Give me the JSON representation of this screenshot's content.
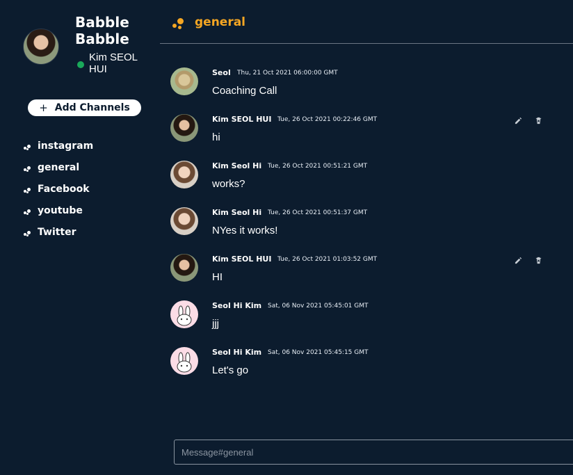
{
  "app": {
    "title": "Babble Babble"
  },
  "user": {
    "name": "Kim SEOL HUI",
    "status": "online",
    "status_color": "#1aa85a"
  },
  "sidebar": {
    "add_channels_label": "Add Channels",
    "channels": [
      {
        "label": "instagram"
      },
      {
        "label": "general"
      },
      {
        "label": "Facebook"
      },
      {
        "label": "youtube"
      },
      {
        "label": "Twitter"
      }
    ]
  },
  "header": {
    "channel_name": "general",
    "accent_color": "#f5a623"
  },
  "messages": [
    {
      "author": "Seol",
      "timestamp": "Thu, 21 Oct 2021 06:00:00 GMT",
      "text": "Coaching Call",
      "avatar": "photo-seol",
      "editable": false
    },
    {
      "author": "Kim SEOL HUI",
      "timestamp": "Tue, 26 Oct 2021 00:22:46 GMT",
      "text": "hi",
      "avatar": "photo-kim",
      "editable": true
    },
    {
      "author": "Kim Seol Hi",
      "timestamp": "Tue, 26 Oct 2021 00:51:21 GMT",
      "text": "works?",
      "avatar": "photo-hi",
      "editable": false
    },
    {
      "author": "Kim Seol Hi",
      "timestamp": "Tue, 26 Oct 2021 00:51:37 GMT",
      "text": "NYes it works!",
      "avatar": "photo-hi",
      "editable": false
    },
    {
      "author": "Kim SEOL HUI",
      "timestamp": "Tue, 26 Oct 2021 01:03:52 GMT",
      "text": "HI",
      "avatar": "photo-kim",
      "editable": true
    },
    {
      "author": "Seol Hi Kim",
      "timestamp": "Sat, 06 Nov 2021 05:45:01 GMT",
      "text": "jjj",
      "avatar": "bunny-icon",
      "editable": false
    },
    {
      "author": "Seol Hi Kim",
      "timestamp": "Sat, 06 Nov 2021 05:45:15 GMT",
      "text": "Let's go",
      "avatar": "bunny-icon",
      "editable": false
    }
  ],
  "composer": {
    "placeholder": "Message#general",
    "value": ""
  },
  "icons": {
    "edit": "pencil-icon",
    "delete": "trash-icon",
    "channel": "dots-icon"
  }
}
